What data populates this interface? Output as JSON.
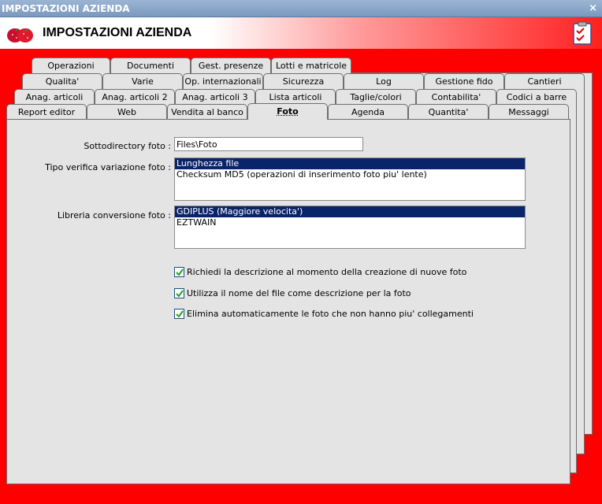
{
  "window": {
    "title": "IMPOSTAZIONI AZIENDA",
    "close_glyph": "×"
  },
  "header": {
    "title": "IMPOSTAZIONI AZIENDA"
  },
  "tabs": {
    "row1": [
      "Operazioni",
      "Documenti",
      "Gest. presenze",
      "Lotti e matricole"
    ],
    "row2": [
      "Qualita'",
      "Varie",
      "Op. internazionali",
      "Sicurezza",
      "Log",
      "Gestione fido",
      "Cantieri"
    ],
    "row3": [
      "Anag. articoli",
      "Anag. articoli 2",
      "Anag. articoli 3",
      "Lista articoli",
      "Taglie/colori",
      "Contabilita'",
      "Codici a barre"
    ],
    "row4": [
      "Report editor",
      "Web",
      "Vendita al banco",
      "Foto",
      "Agenda",
      "Quantita'",
      "Messaggi"
    ]
  },
  "form": {
    "subdir_label": "Sottodirectory foto :",
    "subdir_value": "Files\\Foto",
    "verifica_label": "Tipo verifica variazione foto :",
    "verifica_options": [
      "Lunghezza file",
      "Checksum MD5 (operazioni di inserimento foto piu' lente)"
    ],
    "libreria_label": "Libreria conversione foto :",
    "libreria_options": [
      "GDIPLUS (Maggiore velocita')",
      "EZTWAIN"
    ],
    "check1": "Richiedi la descrizione al momento della creazione di nuove foto",
    "check2": "Utilizza il nome del file come descrizione per la foto",
    "check3": "Elimina automaticamente le foto che non hanno piu' collegamenti"
  },
  "colors": {
    "background": "#ff0000",
    "selection": "#0a246a",
    "panel": "#e4e4e4"
  }
}
